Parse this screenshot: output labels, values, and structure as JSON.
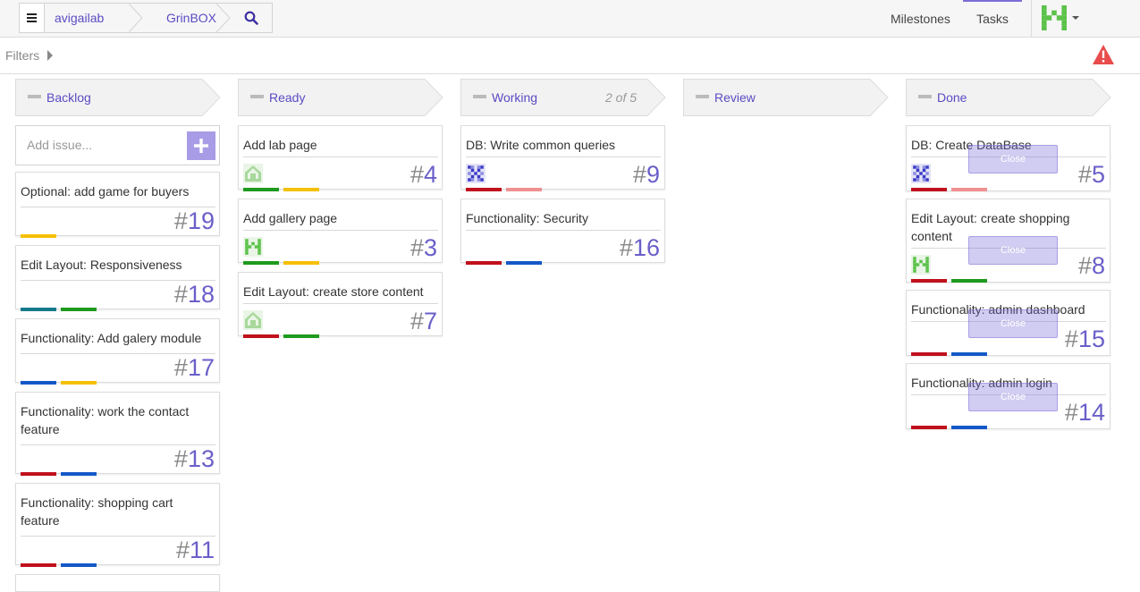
{
  "breadcrumb": {
    "owner": "avigailab",
    "repo": "GrinBOX"
  },
  "nav": {
    "milestones": "Milestones",
    "tasks": "Tasks"
  },
  "filters": {
    "label": "Filters"
  },
  "add_issue": {
    "placeholder": "Add issue..."
  },
  "columns": [
    {
      "title": "Backlog",
      "wip": ""
    },
    {
      "title": "Ready",
      "wip": ""
    },
    {
      "title": "Working",
      "wip": "2 of 5"
    },
    {
      "title": "Review",
      "wip": ""
    },
    {
      "title": "Done",
      "wip": ""
    }
  ],
  "cards": {
    "backlog": [
      {
        "title": "Optional: add game for buyers",
        "number": "19",
        "labels": [
          "#f5c000"
        ]
      },
      {
        "title": "Edit Layout: Responsiveness",
        "number": "18",
        "labels": [
          "#147a8a",
          "#1e9a1e"
        ]
      },
      {
        "title": "Functionality: Add galery module",
        "number": "17",
        "labels": [
          "#1458c8",
          "#f5c000"
        ]
      },
      {
        "title": "Functionality: work the contact feature",
        "number": "13",
        "labels": [
          "#c0101c",
          "#1458c8"
        ]
      },
      {
        "title": "Functionality: shopping cart feature",
        "number": "11",
        "labels": [
          "#c0101c",
          "#1458c8"
        ]
      }
    ],
    "ready": [
      {
        "title": "Add lab page",
        "number": "4",
        "avatar": "identicon-green-house",
        "labels": [
          "#1e9a1e",
          "#f5c000"
        ]
      },
      {
        "title": "Add gallery page",
        "number": "3",
        "avatar": "identicon-green-m",
        "labels": [
          "#1e9a1e",
          "#f5c000"
        ]
      },
      {
        "title": "Edit Layout: create store content",
        "number": "7",
        "avatar": "identicon-green-house",
        "labels": [
          "#c0101c",
          "#1e9a1e"
        ]
      }
    ],
    "working": [
      {
        "title": "DB: Write common queries",
        "number": "9",
        "avatar": "identicon-blue-x",
        "labels": [
          "#c0101c",
          "#f09090"
        ]
      },
      {
        "title": "Functionality: Security",
        "number": "16",
        "labels": [
          "#c0101c",
          "#1458c8"
        ]
      }
    ],
    "done": [
      {
        "title": "DB: Create DataBase",
        "number": "5",
        "avatar": "identicon-blue-x",
        "labels": [
          "#c0101c",
          "#f09090"
        ],
        "close": "Close"
      },
      {
        "title": "Edit Layout: create shopping content",
        "number": "8",
        "avatar": "identicon-green-m",
        "labels": [
          "#c0101c",
          "#1e9a1e"
        ],
        "close": "Close"
      },
      {
        "title": "Functionality: admin dashboard",
        "number": "15",
        "labels": [
          "#c0101c",
          "#1458c8"
        ],
        "close": "Close"
      },
      {
        "title": "Functionality: admin login",
        "number": "14",
        "labels": [
          "#c0101c",
          "#1458c8"
        ],
        "close": "Close"
      }
    ]
  },
  "icons": {
    "menu": "hamburger-icon",
    "search": "search-icon",
    "warning": "warning-icon",
    "add": "plus-icon",
    "user": "identicon-green-m"
  },
  "colors": {
    "accent": "#5b4bc4",
    "add_button": "#a89ce6",
    "warning": "#e84c4c",
    "identicon_green": "#5cc24a",
    "identicon_blue": "#3a3ac8"
  }
}
